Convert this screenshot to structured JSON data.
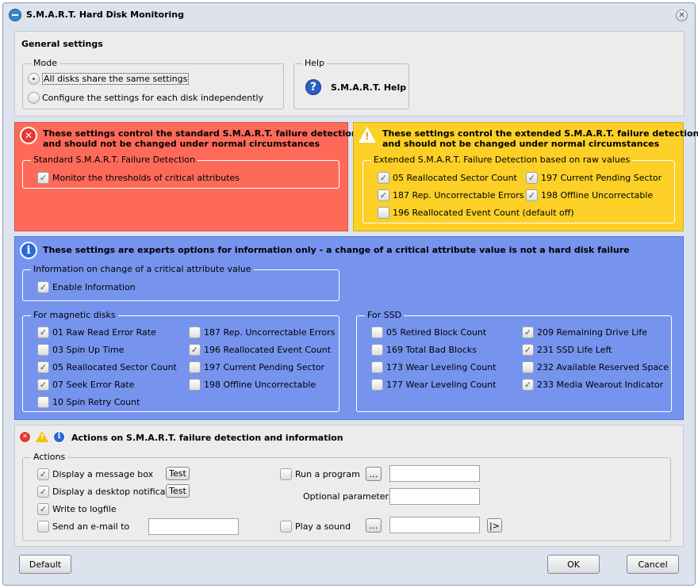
{
  "window": {
    "title": "S.M.A.R.T. Hard Disk Monitoring"
  },
  "general": {
    "title": "General settings",
    "mode": {
      "legend": "Mode",
      "options": [
        "All disks share the same settings",
        "Configure the settings for each disk independently"
      ]
    },
    "help": {
      "legend": "Help",
      "button_label": "S.M.A.R.T. Help"
    }
  },
  "standard": {
    "warning_line1": "These settings control the standard S.M.A.R.T. failure detection",
    "warning_line2": "and should not be changed under normal circumstances",
    "group_legend": "Standard S.M.A.R.T. Failure Detection",
    "monitor_label": "Monitor the thresholds of critical attributes"
  },
  "extended": {
    "warning_line1": "These settings control the extended S.M.A.R.T. failure detection",
    "warning_line2": "and should not be changed under normal circumstances",
    "group_legend": "Extended S.M.A.R.T. Failure Detection based on raw values",
    "items": [
      "05 Reallocated Sector Count",
      "197 Current Pending Sector",
      "187 Rep. Uncorrectable Errors",
      "198 Offline Uncorrectable",
      "196 Reallocated Event Count (default off)"
    ]
  },
  "info": {
    "warning": "These settings are experts options for information only - a change of a critical attribute value is not a hard disk failure",
    "change_legend": "Information on change of a critical attribute value",
    "enable_label": "Enable Information",
    "magnetic_legend": "For magnetic disks",
    "magnetic_items": [
      "01 Raw Read Error Rate",
      "03 Spin Up Time",
      "05 Reallocated Sector Count",
      "07 Seek Error Rate",
      "10 Spin Retry Count",
      "187 Rep. Uncorrectable Errors",
      "196 Reallocated Event Count",
      "197 Current Pending Sector",
      "198 Offline Uncorrectable"
    ],
    "ssd_legend": "For SSD",
    "ssd_items": [
      "05 Retired Block Count",
      "169 Total Bad Blocks",
      "173 Wear Leveling Count",
      "177 Wear Leveling Count",
      "209 Remaining Drive Life",
      "231 SSD Life Left",
      "232 Available Reserved Space",
      "233 Media Wearout Indicator"
    ]
  },
  "actions": {
    "title": "Actions on S.M.A.R.T. failure detection and information",
    "legend": "Actions",
    "display_message": "Display a message box",
    "display_notification": "Display a desktop notification",
    "write_logfile": "Write to logfile",
    "send_email": "Send an e-mail to",
    "test_label": "Test",
    "run_program": "Run a program",
    "optional_params": "Optional parameters",
    "play_sound": "Play a sound",
    "browse_label": "...",
    "play_label": "|>"
  },
  "footer": {
    "default_label": "Default",
    "ok_label": "OK",
    "cancel_label": "Cancel"
  }
}
